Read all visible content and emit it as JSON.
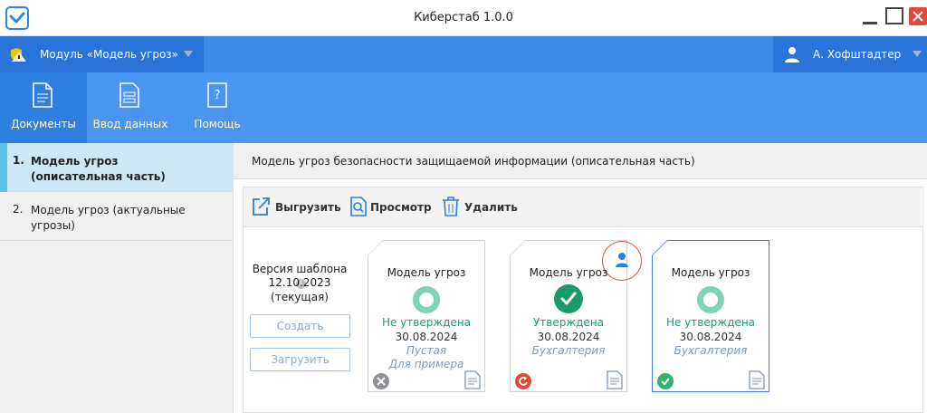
{
  "window": {
    "title": "Киберстаб 1.0.0"
  },
  "module": {
    "label": "Модуль «Модель угроз»"
  },
  "user": {
    "name": "А. Хофштадтер"
  },
  "ribbon": {
    "tabs": [
      {
        "label": "Документы",
        "icon": "document-icon",
        "active": true
      },
      {
        "label": "Ввод данных",
        "icon": "data-entry-icon",
        "active": false
      },
      {
        "label": "Помощь",
        "icon": "help-icon",
        "active": false
      }
    ]
  },
  "sidebar": {
    "items": [
      {
        "num": "1.",
        "label": "Модель угроз (описательная часть)",
        "active": true
      },
      {
        "num": "2.",
        "label": "Модель угроз (актуальные угрозы)",
        "active": false
      }
    ]
  },
  "main": {
    "header": "Модель угроз безопасности защищаемой информации (описательная часть)",
    "toolbar": {
      "export_label": "Выгрузить",
      "view_label": "Просмотр",
      "delete_label": "Удалить"
    },
    "template": {
      "label": "Версия шаблона",
      "date": "12.10.2023",
      "current": "(текущая)",
      "create_label": "Создать",
      "load_label": "Загрузить"
    },
    "cards": [
      {
        "title": "Модель угроз",
        "status": "Не утверждена",
        "date": "30.08.2024",
        "line1": "Пустая",
        "line2": "Для примера",
        "badge": "x-icon"
      },
      {
        "title": "Модель угроз",
        "status": "Утверждена",
        "date": "30.08.2024",
        "line1": "Бухгалтерия",
        "badge": "redo-icon"
      },
      {
        "title": "Модель угроз",
        "status": "Не утверждена",
        "date": "30.08.2024",
        "line1": "Бухгалтерия",
        "badge": "check-icon"
      }
    ]
  },
  "colors": {
    "accent": "#3f8ae8",
    "ribbon": "#4995f0",
    "status_green": "#17a06f",
    "selected_border": "#3f7fd0"
  }
}
